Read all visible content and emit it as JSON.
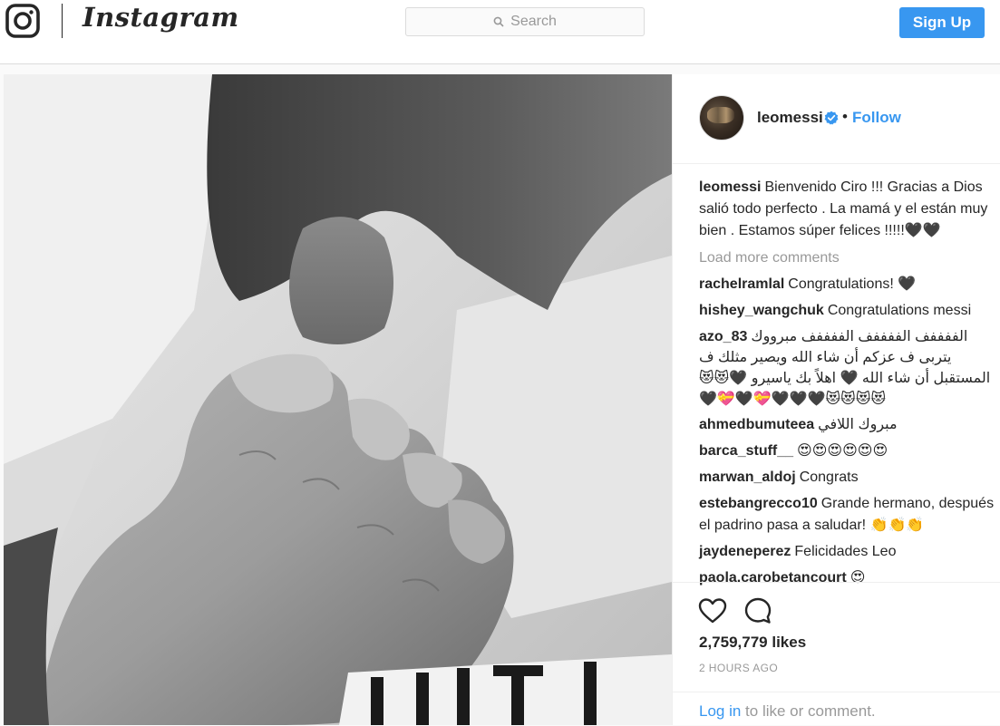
{
  "header": {
    "brand": "Instagram",
    "search_placeholder": "Search",
    "signup_label": "Sign Up"
  },
  "post": {
    "photo_alt": "baby hand holding adult finger",
    "author": {
      "username": "leomessi",
      "verified": true,
      "separator": "•",
      "follow_label": "Follow"
    },
    "caption": {
      "username": "leomessi",
      "text": "Bienvenido Ciro !!! Gracias a Dios salió todo perfecto . La mamá y el están muy bien . Estamos súper felices !!!!!🖤🖤"
    },
    "load_more_label": "Load more comments",
    "comments": [
      {
        "username": "rachelramlal",
        "text": "Congratulations! 🖤"
      },
      {
        "username": "hishey_wangchuk",
        "text": "Congratulations messi"
      },
      {
        "username": "azo_83",
        "text": "الففففف الففففف الففففف مبرووك يتربى ف عزكم أن شاء الله ويصير مثلك ف المستقبل أن شاء الله 🖤 اهلاً بك ياسيرو 🖤😻😻😻😻😻😻🖤🖤🖤💝🖤💝🖤"
      },
      {
        "username": "ahmedbumuteea",
        "text": "مبروك اللافي"
      },
      {
        "username": "barca_stuff__",
        "text": "😍😍😍😍😍😍"
      },
      {
        "username": "marwan_aldoj",
        "text": "Congrats"
      },
      {
        "username": "estebangrecco10",
        "text": "Grande hermano, después el padrino pasa a saludar! 👏👏👏"
      },
      {
        "username": "jaydeneperez",
        "text": "Felicidades Leo"
      },
      {
        "username": "paola.carobetancourt",
        "text": "😍"
      }
    ],
    "likes": "2,759,779 likes",
    "time_ago": "2 HOURS AGO",
    "login_prompt": {
      "link": "Log in",
      "rest": " to like or comment."
    }
  },
  "colors": {
    "accent": "#3897f0",
    "muted": "#999999",
    "text": "#262626",
    "border": "#dbdbdb"
  },
  "icons": [
    "instagram-glyph-icon",
    "search-icon",
    "verified-badge-icon",
    "heart-icon",
    "comment-icon"
  ]
}
